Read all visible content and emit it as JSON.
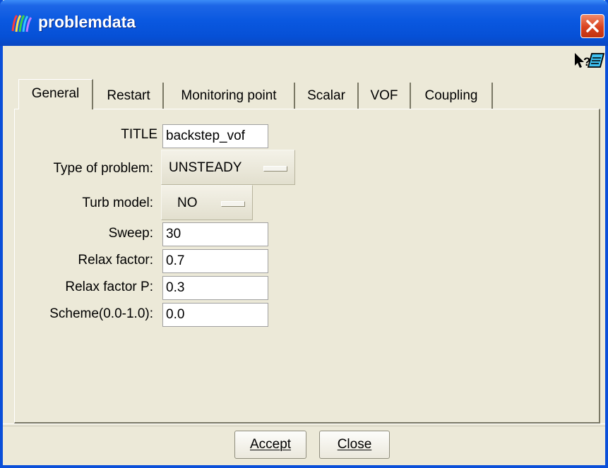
{
  "window": {
    "title": "problemdata"
  },
  "tabs": [
    {
      "label": "General",
      "active": true
    },
    {
      "label": "Restart"
    },
    {
      "label": "Monitoring point"
    },
    {
      "label": "Scalar"
    },
    {
      "label": "VOF"
    },
    {
      "label": "Coupling"
    }
  ],
  "form": {
    "title": {
      "label": "TITLE",
      "value": "backstep_vof"
    },
    "type_of_problem": {
      "label": "Type of problem:",
      "value": "UNSTEADY"
    },
    "turb_model": {
      "label": "Turb model:",
      "value": "NO"
    },
    "sweep": {
      "label": "Sweep:",
      "value": "30"
    },
    "relax_factor": {
      "label": "Relax factor:",
      "value": "0.7"
    },
    "relax_factor_p": {
      "label": "Relax factor P:",
      "value": "0.3"
    },
    "scheme": {
      "label": "Scheme(0.0-1.0):",
      "value": "0.0"
    }
  },
  "buttons": {
    "accept": "Accept",
    "close": "Close"
  },
  "icons": [
    "app-icon",
    "close-icon",
    "whats-this-help-icon",
    "context-help-icon",
    "menu-indicator-icon"
  ],
  "colors": {
    "titlebar": "#0a58e0",
    "background": "#ece9d8",
    "close": "#d9421e"
  }
}
